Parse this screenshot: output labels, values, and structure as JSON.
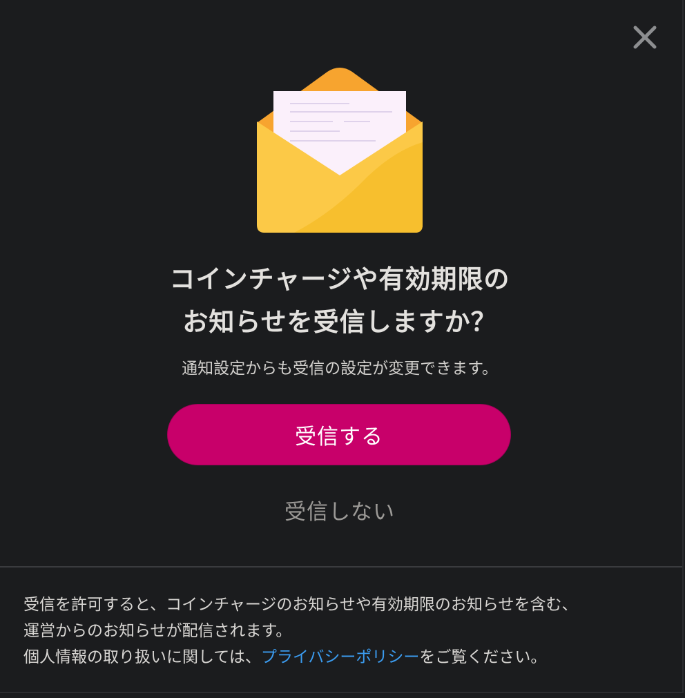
{
  "dialog": {
    "close_icon": "close-icon",
    "illustration_icon": "open-envelope-icon",
    "title_line1": "コインチャージや有効期限の",
    "title_line2": "お知らせを受信しますか？",
    "subtitle": "通知設定からも受信の設定が変更できます。",
    "accept_label": "受信する",
    "decline_label": "受信しない",
    "footer": {
      "line1": "受信を許可すると、コインチャージのお知らせや有効期限のお知らせを含む、",
      "line2": "運営からのお知らせが配信されます。",
      "line3_prefix": "個人情報の取り扱いに関しては、",
      "privacy_link": "プライバシーポリシー",
      "line3_suffix": "をご覧ください。"
    }
  },
  "colors": {
    "background": "#1b1c1e",
    "accent": "#c8006a",
    "link": "#3b9cf0",
    "envelope_back": "#f7a42f",
    "envelope_front": "#fcc947",
    "letter": "#fbf0fb"
  }
}
